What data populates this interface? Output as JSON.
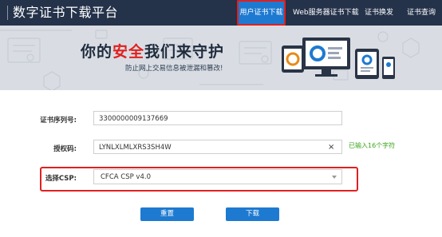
{
  "header": {
    "title": "数字证书下载平台",
    "nav": [
      {
        "label": "用户证书下载",
        "active": true
      },
      {
        "label": "Web服务器证书下载",
        "active": false
      },
      {
        "label": "证书换发",
        "active": false
      },
      {
        "label": "证书查询",
        "active": false
      }
    ]
  },
  "banner": {
    "headline_before": "你的",
    "headline_accent": "安全",
    "headline_after": "我们来守护",
    "tagline": "防止网上交易信息被泄漏和篡改!"
  },
  "form": {
    "serial_label": "证书序列号:",
    "serial_value": "3300000009137669",
    "auth_label": "授权码:",
    "auth_value": "LYNLXLMLXRS3SH4W",
    "auth_clear": "×",
    "auth_hint": "已输入16个字符",
    "csp_label": "选择CSP:",
    "csp_value": "CFCA CSP v4.0"
  },
  "buttons": {
    "reset": "重置",
    "download": "下载"
  },
  "colors": {
    "topbar": "#24324a",
    "accent_blue": "#1e7ad0",
    "highlight_red": "#e02020",
    "hint_green": "#3aa51a"
  }
}
